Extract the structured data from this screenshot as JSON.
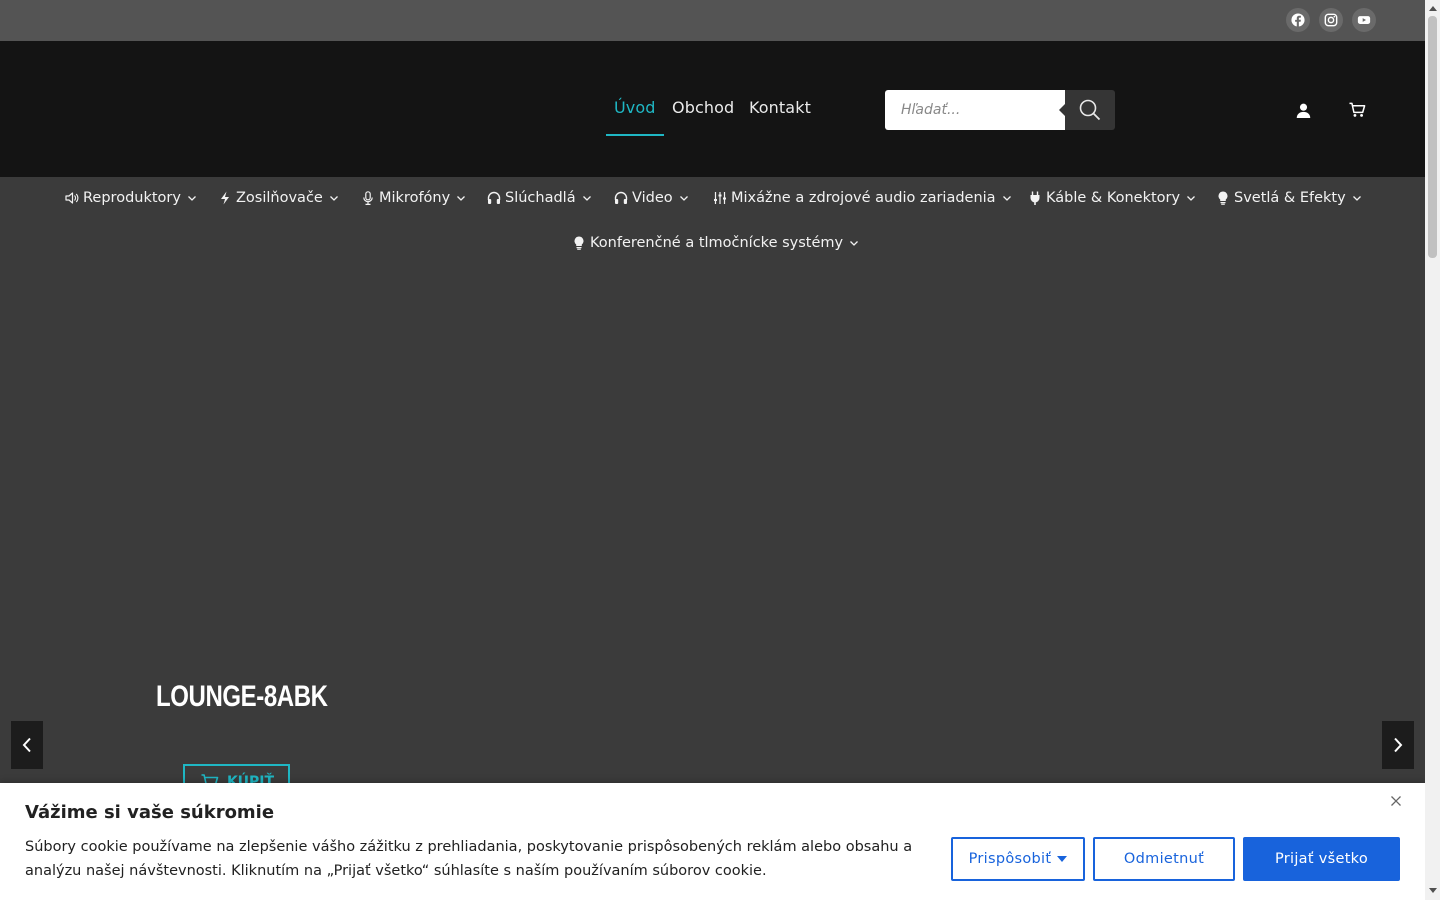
{
  "topbar": {
    "social_icons": [
      "facebook-icon",
      "instagram-icon",
      "youtube-icon"
    ]
  },
  "header": {
    "nav": [
      {
        "label": "Úvod",
        "active": true
      },
      {
        "label": "Obchod",
        "active": false
      },
      {
        "label": "Kontakt",
        "active": false
      }
    ],
    "search": {
      "placeholder": "Hľadať..."
    },
    "icons": [
      "user-icon",
      "cart-icon"
    ]
  },
  "categories": [
    {
      "label": "Reproduktory",
      "icon": "speaker-icon"
    },
    {
      "label": "Zosilňovače",
      "icon": "bolt-icon"
    },
    {
      "label": "Mikrofóny",
      "icon": "microphone-icon"
    },
    {
      "label": "Slúchadlá",
      "icon": "headphones-icon"
    },
    {
      "label": "Video",
      "icon": "headphones-icon"
    },
    {
      "label": "Mixážne a zdrojové audio zariadenia",
      "icon": "sliders-icon"
    },
    {
      "label": "Káble & Konektory",
      "icon": "plug-icon"
    },
    {
      "label": "Svetlá & Efekty",
      "icon": "lightbulb-icon"
    },
    {
      "label": "Konferenčné a tlmočnícke systémy",
      "icon": "lightbulb-icon"
    }
  ],
  "hero": {
    "title": "LOUNGE-8ABK",
    "button_label": "KÚPIŤ"
  },
  "cookie": {
    "title": "Vážime si vaše súkromie",
    "text": "Súbory cookie používame na zlepšenie vášho zážitku z prehliadania, poskytovanie prispôsobených reklám alebo obsahu a analýzu našej návštevnosti. Kliknutím na „Prijať všetko“ súhlasíte s naším používaním súborov cookie.",
    "customize_label": "Prispôsobiť",
    "reject_label": "Odmietnuť",
    "accept_label": "Prijať všetko"
  },
  "colors": {
    "accent": "#1fb7c4",
    "cookie_blue": "#1863dc",
    "header_bg": "#141414",
    "topbar_bg": "#545454",
    "hero_bg": "#3b3b3b"
  }
}
